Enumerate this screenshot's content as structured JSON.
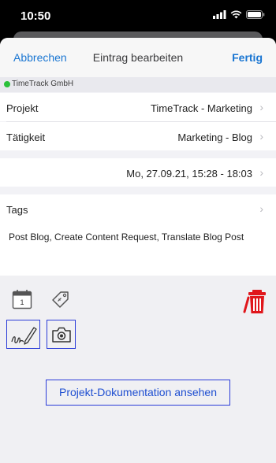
{
  "status": {
    "time": "10:50"
  },
  "nav": {
    "cancel": "Abbrechen",
    "title": "Eintrag bearbeiten",
    "done": "Fertig"
  },
  "company": {
    "name": "TimeTrack GmbH",
    "status_color": "#2bc13a"
  },
  "fields": {
    "project": {
      "label": "Projekt",
      "value": "TimeTrack - Marketing"
    },
    "activity": {
      "label": "Tätigkeit",
      "value": "Marketing - Blog"
    },
    "time_range": {
      "value": "Mo, 27.09.21, 15:28 - 18:03"
    },
    "tags": {
      "label": "Tags",
      "value": "Post Blog, Create Content Request, Translate Blog Post"
    }
  },
  "toolbar": {
    "calendar_day": "1",
    "icons": [
      "calendar-icon",
      "tag-icon",
      "trash-icon",
      "signature-icon",
      "camera-icon"
    ],
    "accent": "#e0161b"
  },
  "doc_button": {
    "label": "Projekt-Dokumentation ansehen"
  },
  "colors": {
    "link": "#1a76d2",
    "frame": "#2a3bd8"
  }
}
